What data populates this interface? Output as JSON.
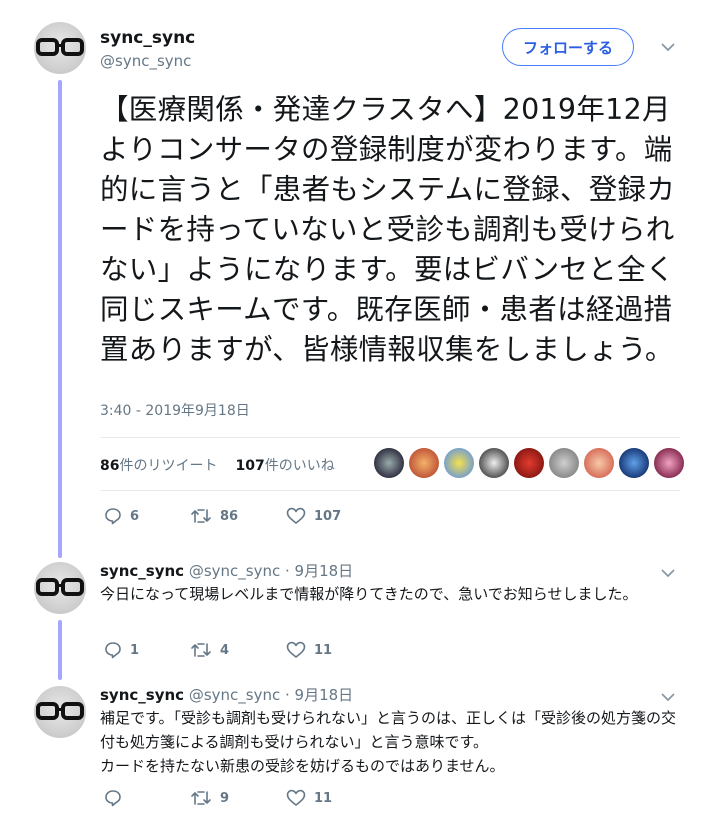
{
  "main_tweet": {
    "name": "sync_sync",
    "handle": "@sync_sync",
    "follow_label": "フォローする",
    "text": "【医療関係・発達クラスタへ】2019年12月よりコンサータの登録制度が変わります。端的に言うと「患者もシステムに登録、登録カードを持っていないと受診も調剤も受けられない」ようになります。要はビバンセと全く同じスキームです。既存医師・患者は経過措置ありますが、皆様情報収集をしましょう。",
    "timestamp": "3:40 - 2019年9月18日",
    "retweets_count": "86",
    "retweets_label": "件のリツイート",
    "likes_count": "107",
    "likes_label": "件のいいね",
    "actions": {
      "reply": "6",
      "retweet": "86",
      "like": "107"
    }
  },
  "replies": [
    {
      "name": "sync_sync",
      "handle_date": "@sync_sync · 9月18日",
      "text": "今日になって現場レベルまで情報が降りてきたので、急いでお知らせしました。",
      "actions": {
        "reply": "1",
        "retweet": "4",
        "like": "11"
      }
    },
    {
      "name": "sync_sync",
      "handle_date": "@sync_sync · 9月18日",
      "text": "補足です。「受診も調剤も受けられない」と言うのは、正しくは「受診後の処方箋の交付も処方箋による調剤も受けられない」と言う意味です。\nカードを持たない新患の受診を妨げるものではありません。",
      "actions": {
        "reply": "",
        "retweet": "9",
        "like": "11"
      }
    }
  ],
  "colors": {
    "thread_line": "#a7a6ff",
    "follow_border": "#4a7cff",
    "muted": "#657786"
  },
  "icons": [
    "reply-icon",
    "retweet-icon",
    "like-icon",
    "chevron-down-icon"
  ]
}
